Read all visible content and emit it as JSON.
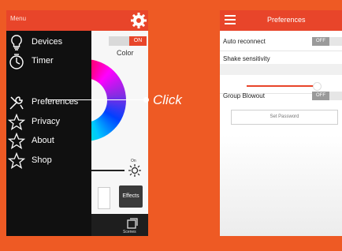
{
  "left_screen": {
    "menu_title": "Menu",
    "menu_items": [
      {
        "label": "Devices",
        "icon": "bulb-icon"
      },
      {
        "label": "Timer",
        "icon": "timer-icon"
      },
      {
        "label": "Preferences",
        "icon": "wrench-icon"
      },
      {
        "label": "Privacy",
        "icon": "star-icon"
      },
      {
        "label": "About",
        "icon": "star-icon"
      },
      {
        "label": "Shop",
        "icon": "star-icon"
      }
    ],
    "app": {
      "on_label": "ON",
      "color_label": "Color",
      "brightness_on_label": "On",
      "effects_label": "Effects",
      "scenes_label": "Scenes"
    },
    "annotation": "Click"
  },
  "right_screen": {
    "title": "Preferences",
    "auto_reconnect": {
      "label": "Auto reconnect",
      "toggle": "OFF"
    },
    "shake": {
      "label": "Shake sensitivity",
      "value": 0.95
    },
    "group_blowout": {
      "label": "Group Blowout",
      "toggle": "OFF"
    },
    "password_button": "Set Password"
  },
  "colors": {
    "background": "#ee5a24",
    "accent": "#e8452a",
    "drawer": "#101010"
  }
}
